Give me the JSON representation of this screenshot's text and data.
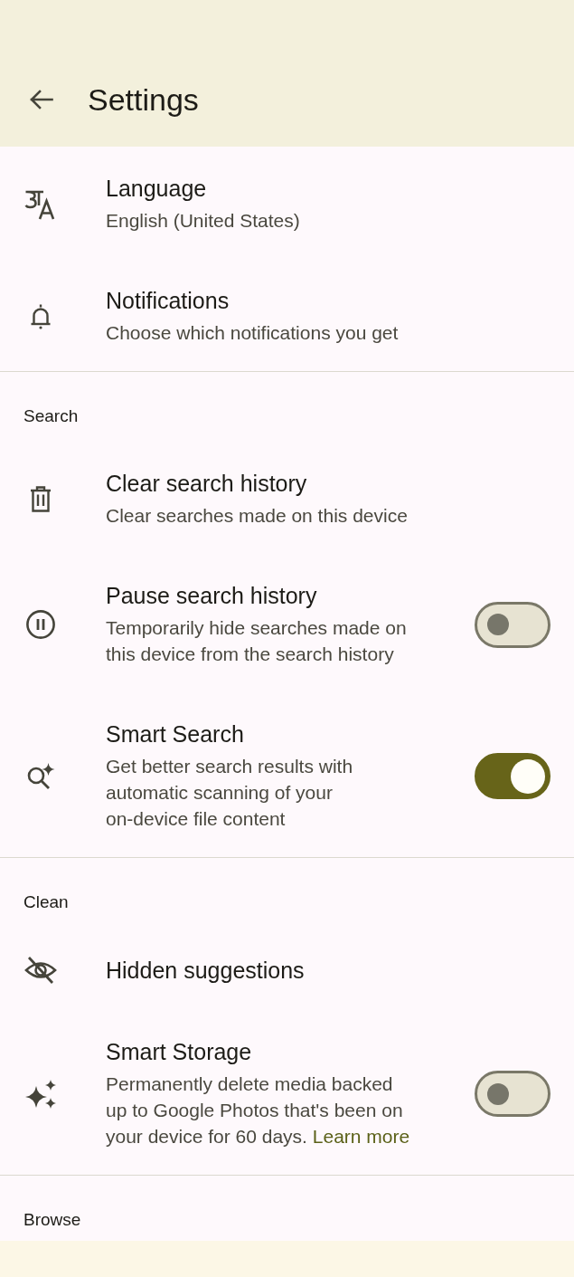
{
  "app_bar": {
    "title": "Settings"
  },
  "sections": [
    {
      "items": [
        {
          "kind": "plain",
          "title": "Language",
          "subtitle": "English (United States)"
        },
        {
          "kind": "plain",
          "title": "Notifications",
          "subtitle": "Choose which notifications you get"
        }
      ]
    },
    {
      "header": "Search",
      "items": [
        {
          "kind": "plain",
          "title": "Clear search history",
          "subtitle": "Clear searches made on this device"
        },
        {
          "kind": "switch",
          "title": "Pause search history",
          "subtitle": "Temporarily hide searches made on\nthis device from the search history",
          "on": false
        },
        {
          "kind": "switch",
          "title": "Smart Search",
          "subtitle": "Get better search results with\nautomatic scanning of your\non-device file content",
          "on": true
        }
      ]
    },
    {
      "header": "Clean",
      "items": [
        {
          "kind": "plain",
          "title": "Hidden suggestions"
        },
        {
          "kind": "switch",
          "title": "Smart Storage",
          "subtitle": "Permanently delete media backed\nup to Google Photos that's been on\nyour device for 60 days.",
          "link": "Learn more",
          "on": false
        }
      ]
    },
    {
      "header": "Browse"
    }
  ]
}
